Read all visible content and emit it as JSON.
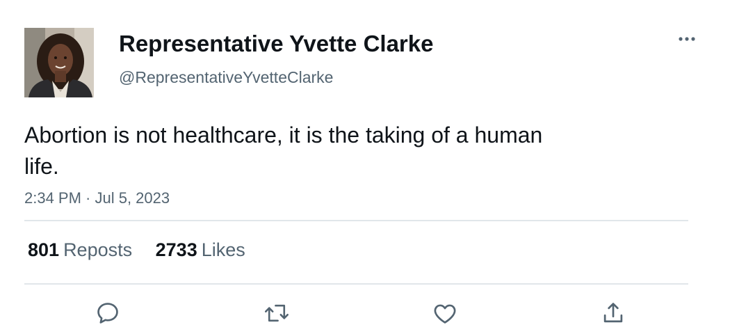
{
  "author": {
    "display_name": "Representative Yvette Clarke",
    "handle": "@RepresentativeYvetteClarke",
    "avatar": "profile-photo"
  },
  "tweet": {
    "text": "Abortion is not healthcare, it is the taking of a human life.",
    "timestamp": "2:34 PM · Jul 5, 2023"
  },
  "stats": {
    "reposts_count": "801",
    "reposts_label": "Reposts",
    "likes_count": "2733",
    "likes_label": "Likes"
  },
  "actions": [
    {
      "icon": "reply-icon"
    },
    {
      "icon": "repost-icon"
    },
    {
      "icon": "like-icon"
    },
    {
      "icon": "share-icon"
    }
  ],
  "colors": {
    "text": "#0f1419",
    "secondary": "#536471",
    "divider": "#e1e6ea"
  }
}
